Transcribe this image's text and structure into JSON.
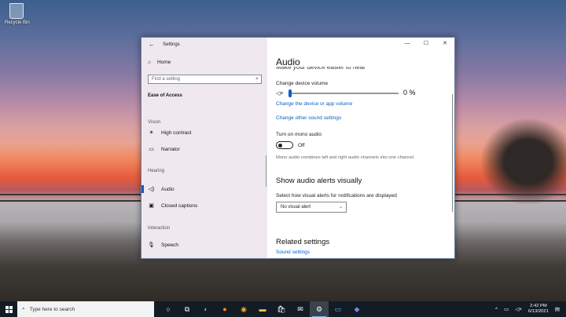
{
  "desktop": {
    "recycle_bin_label": "Recycle Bin"
  },
  "window": {
    "title": "Settings",
    "controls": {
      "minimize": "—",
      "maximize": "☐",
      "close": "✕"
    }
  },
  "sidebar": {
    "home_label": "Home",
    "search_placeholder": "Find a setting",
    "section_title": "Ease of Access",
    "groups": [
      {
        "label": "Vision",
        "items": [
          {
            "label": "High contrast",
            "icon": "high-contrast-icon"
          },
          {
            "label": "Narrator",
            "icon": "narrator-icon"
          }
        ]
      },
      {
        "label": "Hearing",
        "items": [
          {
            "label": "Audio",
            "icon": "audio-icon",
            "active": true
          },
          {
            "label": "Closed captions",
            "icon": "closed-captions-icon"
          }
        ]
      },
      {
        "label": "Interaction",
        "items": [
          {
            "label": "Speech",
            "icon": "microphone-icon"
          }
        ]
      }
    ]
  },
  "main": {
    "heading": "Audio",
    "cut_subheading": "Make your device easier to hear",
    "volume_label": "Change device volume",
    "volume_value": "0 %",
    "volume_level": 0,
    "link_device_volume": "Change the device or app volume",
    "link_other_sound": "Change other sound settings",
    "mono_label": "Turn on mono audio",
    "mono_state": "Off",
    "mono_note": "Mono audio combines left and right audio channels into one channel.",
    "alerts_heading": "Show audio alerts visually",
    "alerts_label": "Select how visual alerts for notifications are displayed",
    "alerts_value": "No visual alert",
    "related_heading": "Related settings",
    "related_link": "Sound settings"
  },
  "taskbar": {
    "search_placeholder": "Type here to search",
    "pinned": [
      "cortana-icon",
      "task-view-icon",
      "edge-icon",
      "firefox-icon",
      "chrome-icon",
      "file-explorer-icon",
      "store-icon",
      "mail-icon",
      "settings-icon",
      "app-icon",
      "teams-icon"
    ],
    "active_app": "settings-icon",
    "time": "2:42 PM",
    "date": "6/13/2021"
  },
  "colors": {
    "accent": "#0a5fc6",
    "taskbar": "#131b24"
  }
}
